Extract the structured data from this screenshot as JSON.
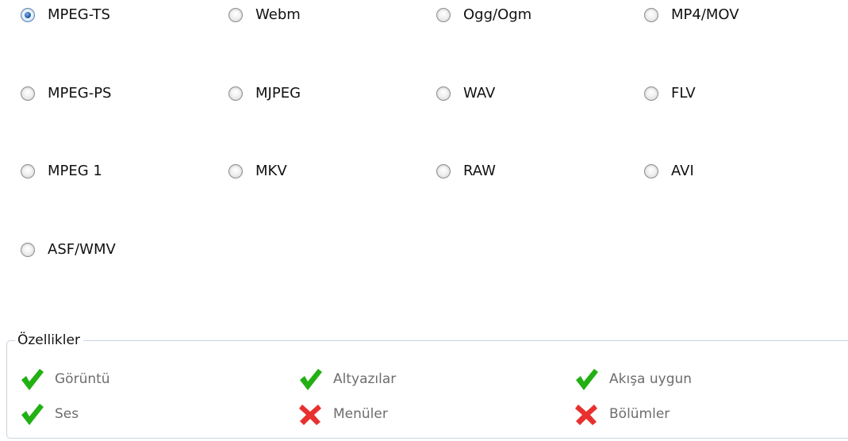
{
  "formats": [
    {
      "label": "MPEG-TS",
      "checked": true
    },
    {
      "label": "Webm",
      "checked": false
    },
    {
      "label": "Ogg/Ogm",
      "checked": false
    },
    {
      "label": "MP4/MOV",
      "checked": false
    },
    {
      "label": "MPEG-PS",
      "checked": false
    },
    {
      "label": "MJPEG",
      "checked": false
    },
    {
      "label": "WAV",
      "checked": false
    },
    {
      "label": "FLV",
      "checked": false
    },
    {
      "label": "MPEG 1",
      "checked": false
    },
    {
      "label": "MKV",
      "checked": false
    },
    {
      "label": "RAW",
      "checked": false
    },
    {
      "label": "AVI",
      "checked": false
    },
    {
      "label": "ASF/WMV",
      "checked": false
    }
  ],
  "features": {
    "title": "Özellikler",
    "items": [
      {
        "label": "Görüntü",
        "supported": true,
        "icon": "check-icon"
      },
      {
        "label": "Altyazılar",
        "supported": true,
        "icon": "check-icon"
      },
      {
        "label": "Akışa uygun",
        "supported": true,
        "icon": "check-icon"
      },
      {
        "label": "Ses",
        "supported": true,
        "icon": "check-icon"
      },
      {
        "label": "Menüler",
        "supported": false,
        "icon": "cross-icon"
      },
      {
        "label": "Bölümler",
        "supported": false,
        "icon": "cross-icon"
      }
    ]
  },
  "colors": {
    "check": "#22b014",
    "cross": "#e8312f",
    "radio_selected": "#1f5da3",
    "group_border": "#c9d3dd",
    "feature_text": "#6d6d6d"
  }
}
